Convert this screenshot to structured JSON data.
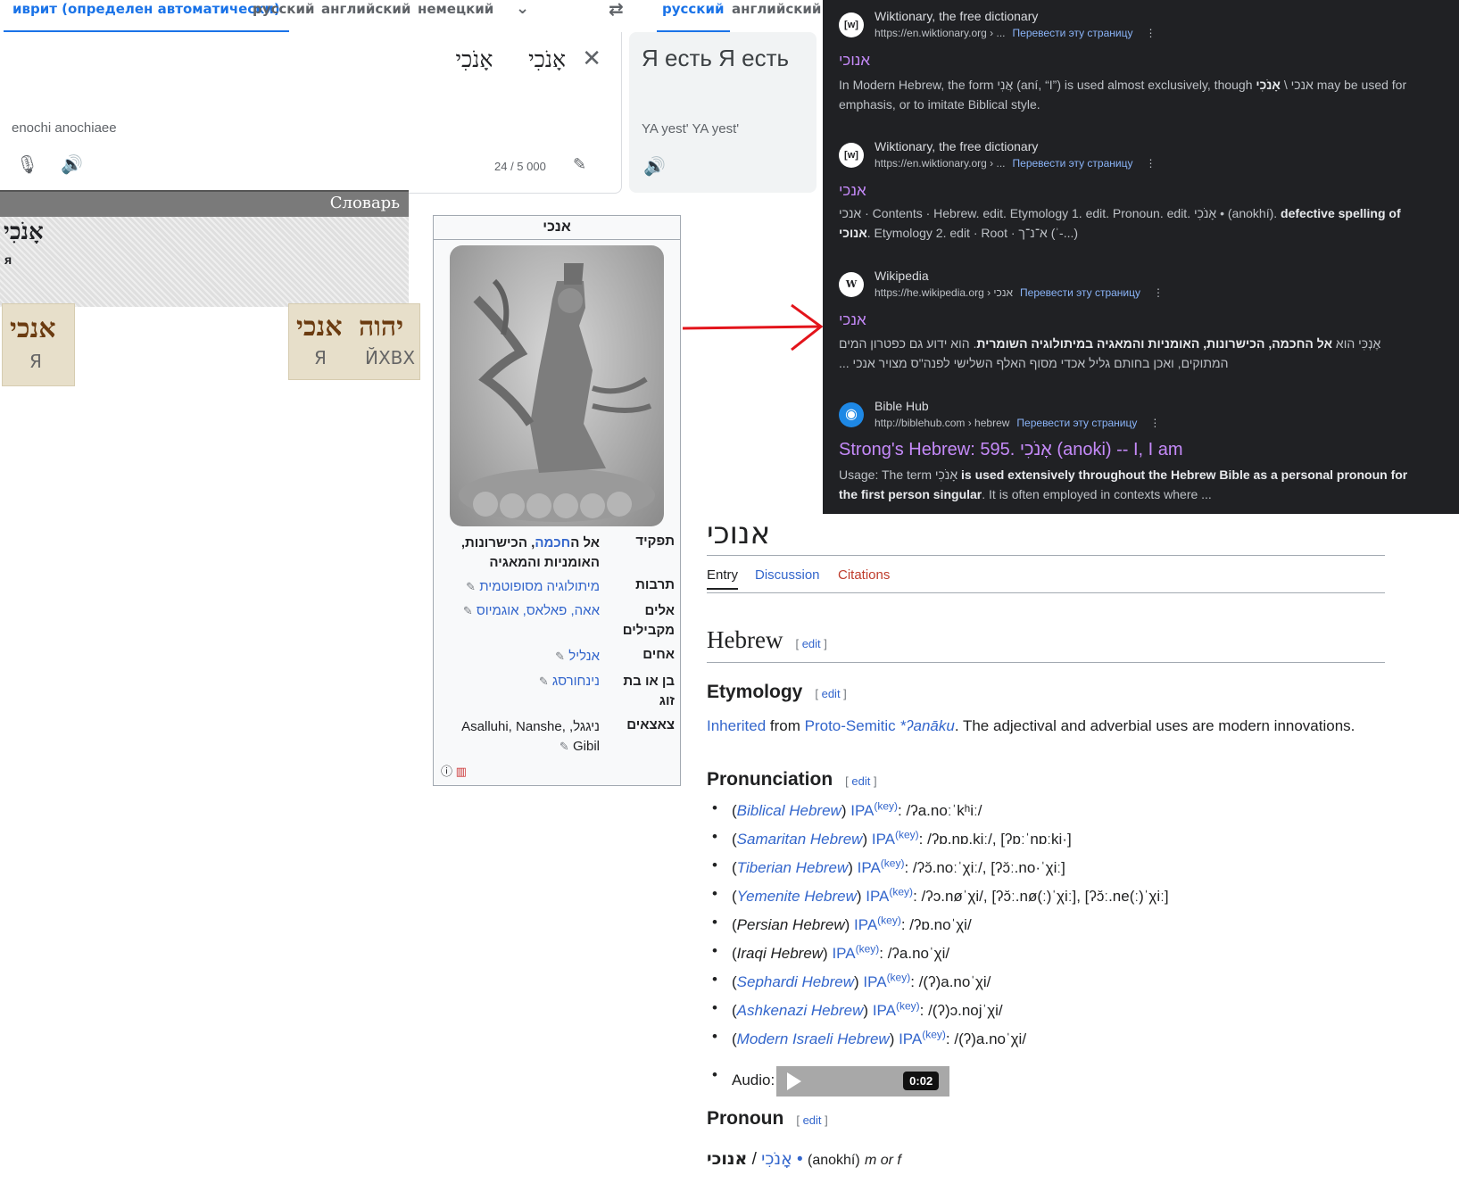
{
  "translate": {
    "source_tabs": [
      "иврит (определен автоматически)",
      "русский",
      "английский",
      "немецкий"
    ],
    "target_tabs": [
      "русский",
      "английский"
    ],
    "source_text": "אָנֹכִי     אָנֹכִי",
    "source_translit": "enochi anochiaee",
    "char_count": "24 / 5 000",
    "target_text": "Я есть Я есть",
    "target_translit": "YA yest' YA yest'",
    "icons": {
      "expand": "chevron-down-icon",
      "swap": "swap-icon",
      "clear": "close-icon",
      "mic": "mic-icon",
      "speaker": "speaker-icon",
      "edit": "pencil-icon"
    }
  },
  "dictionary": {
    "header": "Словарь",
    "word": "אָנֹכִי",
    "translation": "я",
    "tiles": [
      {
        "hebrew": "אנכי",
        "russian": "Я"
      },
      {
        "hebrew": "יהוה",
        "russian": "ЙХВХ"
      },
      {
        "hebrew": "אנכי",
        "russian": "Я"
      }
    ]
  },
  "infobox": {
    "title": "אנכי",
    "rows": [
      {
        "label": "תפקיד",
        "value_pre": "אל ה",
        "value_link": "חכמה",
        "value_post": ", הכישרונות, האומניות והמאגיה"
      },
      {
        "label": "תרבות",
        "value_link": "מיתולוגיה מסופוטמית"
      },
      {
        "label": "אלים מקבילים",
        "value_link": "אאה, פאלאס, אוגמיוס"
      },
      {
        "label": "אחים",
        "value_link": "אנליל"
      },
      {
        "label": "בן או בת זוג",
        "value_link": "נינחורסג"
      },
      {
        "label": "צאצאים",
        "value_plain": "ניגגל, Asalluhi, Nanshe, Gibil"
      }
    ]
  },
  "search": {
    "results": [
      {
        "site": "Wiktionary, the free dictionary",
        "url": "https://en.wiktionary.org › ...",
        "translate": "Перевести эту страницу",
        "favicon": "[w]",
        "title": "אנוכי",
        "snippet_html": "In Modern Hebrew, the form אֲנִי (aní, “I”) is used almost exclusively, though אנכי \\ <b>אָנֹכִי</b> may be used for emphasis, or to imitate Biblical style."
      },
      {
        "site": "Wiktionary, the free dictionary",
        "url": "https://en.wiktionary.org › ...",
        "translate": "Перевести эту страницу",
        "favicon": "[w]",
        "title": "אנכי",
        "snippet_html": "אנכי · Contents · Hebrew. edit. Etymology 1. edit. Pronoun. edit. אָנֹכִי • (anokhí). <b>defective spelling of אנוכי</b>. Etymology 2. edit · Root · א־נ־ך (ʾ-...)"
      },
      {
        "site": "Wikipedia",
        "url": "https://he.wikipedia.org › אנכי",
        "translate": "Перевести эту страницу",
        "favicon": "W",
        "title": "אנכי",
        "snippet_html": "אֶנְכִּי הוא <b>אל החכמה, הכישרונות, האומניות והמאגיה במיתולוגיה השומרית</b>. הוא ידוע גם כפטרון המים המתוקים, ואכן בחותם גליל אכדי מסוף האלף השלישי לפנה\"ס מצויר אנכי ..."
      },
      {
        "site": "Bible Hub",
        "url": "http://biblehub.com › hebrew",
        "translate": "Перевести эту страницу",
        "favicon": "◉",
        "title": "Strong's Hebrew: 595. אָנֹכִי (anoki) -- I, I am",
        "snippet_html": "Usage: The term אָנֹכִי <b>is used extensively throughout the Hebrew Bible as a personal pronoun for the first person singular</b>. It is often employed in contexts where ..."
      }
    ],
    "more_icon": "more-vert-icon"
  },
  "arrow": {
    "color": "#e3141b"
  },
  "wiktionary": {
    "title": "אנוכי",
    "tabs": [
      "Entry",
      "Discussion",
      "Citations"
    ],
    "lang_heading": "Hebrew",
    "edit": "edit",
    "etymology_heading": "Etymology",
    "etymology": {
      "inherited": "Inherited",
      "from": " from ",
      "proto": "Proto-Semitic",
      "reconstructed": "*ʔanāku",
      "rest": ". The adjectival and adverbial uses are modern innovations."
    },
    "pronunciation_heading": "Pronunciation",
    "pronunciations": [
      {
        "dialect": "Biblical Hebrew",
        "linked": true,
        "ipa": "/ʔa.noːˈkʰiː/"
      },
      {
        "dialect": "Samaritan Hebrew",
        "linked": true,
        "ipa": "/ʔɒ.nɒ.kiː/, [ʔɒːˈnɒːki·]"
      },
      {
        "dialect": "Tiberian Hebrew",
        "linked": true,
        "ipa": "/ʔɔ̆.noːˈχiː/, [ʔɔ̆ː.no·ˈχiː]"
      },
      {
        "dialect": "Yemenite Hebrew",
        "linked": true,
        "ipa": "/ʔɔ.nøˈχi/, [ʔɔ̆ː.nø(ː)ˈχiː], [ʔɔ̆ː.ne(ː)ˈχiː]"
      },
      {
        "dialect": "Persian Hebrew",
        "linked": false,
        "ipa": "/ʔɒ.noˈχi/"
      },
      {
        "dialect": "Iraqi Hebrew",
        "linked": false,
        "ipa": "/ʔa.noˈχi/"
      },
      {
        "dialect": "Sephardi Hebrew",
        "linked": true,
        "ipa": "/(ʔ)a.noˈχi/"
      },
      {
        "dialect": "Ashkenazi Hebrew",
        "linked": true,
        "ipa": "/(ʔ)ɔ.nojˈχi/"
      },
      {
        "dialect": "Modern Israeli Hebrew",
        "linked": true,
        "ipa": "/(ʔ)a.noˈχi/"
      }
    ],
    "ipa_label": "IPA",
    "key_label": "(key)",
    "audio_label": "Audio:",
    "audio_time": "0:02",
    "pronoun_heading": "Pronoun",
    "headword": {
      "pointed": "אָנֹכִי",
      "sep": " / ",
      "plain": "אנוכי",
      "dot": " • ",
      "translit": "(anokhí)",
      "gender": "m or f"
    }
  }
}
